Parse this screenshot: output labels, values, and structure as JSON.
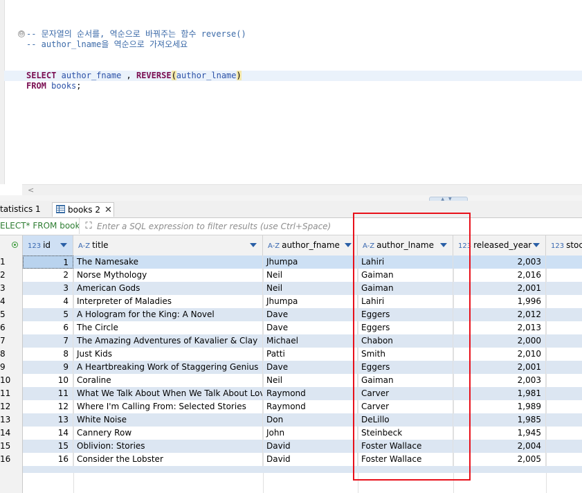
{
  "editor": {
    "comment_line1": "-- 문자열의 순서를, 역순으로 바꿔주는 함수 reverse()",
    "comment_line2": "-- author_lname을 역순으로 가져오세요",
    "kw_select": "SELECT",
    "sel_col1": "author_fname",
    "sel_comma": " , ",
    "kw_reverse": "REVERSE",
    "paren_open": "(",
    "sel_arg": "author_lname",
    "paren_close": ")",
    "kw_from": "FROM",
    "table_name": "books",
    "terminator": ";",
    "fold_icon": "⊖",
    "scroll_left_icon": "<"
  },
  "tabs": [
    {
      "label": "tatistics 1"
    },
    {
      "label": "books 2",
      "close": "✕"
    }
  ],
  "filter": {
    "query_label": "ELECT* FROM books",
    "placeholder": "Enter a SQL expression to filter results (use Ctrl+Space)"
  },
  "grid": {
    "columns": [
      {
        "type": "123",
        "label": "id"
      },
      {
        "type": "A-Z",
        "label": "title"
      },
      {
        "type": "A-Z",
        "label": "author_fname"
      },
      {
        "type": "A-Z",
        "label": "author_lname"
      },
      {
        "type": "123",
        "label": "released_year"
      },
      {
        "type": "123",
        "label": "stock"
      }
    ],
    "rows": [
      {
        "n": "1",
        "id": "1",
        "title": "The Namesake",
        "fname": "Jhumpa",
        "lname": "Lahiri",
        "year": "2,003"
      },
      {
        "n": "2",
        "id": "2",
        "title": "Norse Mythology",
        "fname": "Neil",
        "lname": "Gaiman",
        "year": "2,016"
      },
      {
        "n": "3",
        "id": "3",
        "title": "American Gods",
        "fname": "Neil",
        "lname": "Gaiman",
        "year": "2,001"
      },
      {
        "n": "4",
        "id": "4",
        "title": "Interpreter of Maladies",
        "fname": "Jhumpa",
        "lname": "Lahiri",
        "year": "1,996"
      },
      {
        "n": "5",
        "id": "5",
        "title": "A Hologram for the King: A Novel",
        "fname": "Dave",
        "lname": "Eggers",
        "year": "2,012"
      },
      {
        "n": "6",
        "id": "6",
        "title": "The Circle",
        "fname": "Dave",
        "lname": "Eggers",
        "year": "2,013"
      },
      {
        "n": "7",
        "id": "7",
        "title": "The Amazing Adventures of Kavalier & Clay",
        "fname": "Michael",
        "lname": "Chabon",
        "year": "2,000"
      },
      {
        "n": "8",
        "id": "8",
        "title": "Just Kids",
        "fname": "Patti",
        "lname": "Smith",
        "year": "2,010"
      },
      {
        "n": "9",
        "id": "9",
        "title": "A Heartbreaking Work of Staggering Genius",
        "fname": "Dave",
        "lname": "Eggers",
        "year": "2,001"
      },
      {
        "n": "10",
        "id": "10",
        "title": "Coraline",
        "fname": "Neil",
        "lname": "Gaiman",
        "year": "2,003"
      },
      {
        "n": "11",
        "id": "11",
        "title": "What We Talk About When We Talk About Love: Stories",
        "fname": "Raymond",
        "lname": "Carver",
        "year": "1,981"
      },
      {
        "n": "12",
        "id": "12",
        "title": "Where I'm Calling From: Selected Stories",
        "fname": "Raymond",
        "lname": "Carver",
        "year": "1,989"
      },
      {
        "n": "13",
        "id": "13",
        "title": "White Noise",
        "fname": "Don",
        "lname": "DeLillo",
        "year": "1,985"
      },
      {
        "n": "14",
        "id": "14",
        "title": "Cannery Row",
        "fname": "John",
        "lname": "Steinbeck",
        "year": "1,945"
      },
      {
        "n": "15",
        "id": "15",
        "title": "Oblivion: Stories",
        "fname": "David",
        "lname": "Foster Wallace",
        "year": "2,004"
      },
      {
        "n": "16",
        "id": "16",
        "title": "Consider the Lobster",
        "fname": "David",
        "lname": "Foster Wallace",
        "year": "2,005"
      }
    ]
  },
  "colors": {
    "highlight_box": "#e8101a",
    "row_alt": "#dce6f2",
    "keyword": "#7a0e52",
    "comment": "#3b6aa8"
  }
}
